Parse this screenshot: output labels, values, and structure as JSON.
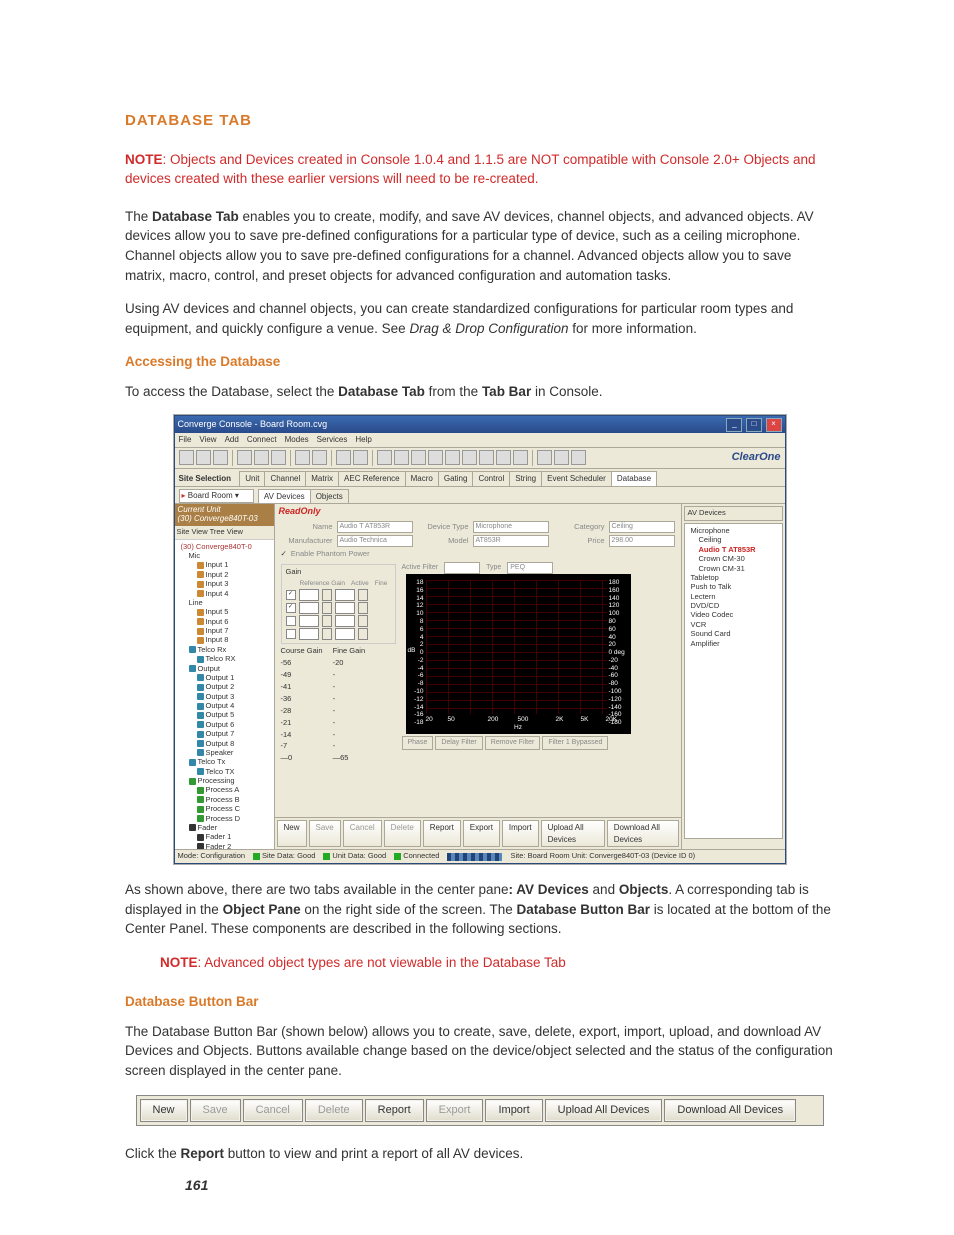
{
  "headings": {
    "main": "DATABASE TAB",
    "accessing": "Accessing the Database",
    "buttonbar": "Database Button Bar"
  },
  "note_top": {
    "prefix": "NOTE",
    "text": ": Objects and Devices created in Console 1.0.4 and 1.1.5 are NOT compatible with Console 2.0+ Objects and devices created with these earlier versions will need to be re-created."
  },
  "para1": {
    "a": "The ",
    "b": "Database Tab",
    "c": " enables you to create, modify, and save AV devices, channel objects, and advanced objects. AV devices allow you to save pre-defined configurations for a particular type of device, such as a ceiling microphone. Channel objects allow you to save pre-defined configurations for a channel. Advanced objects allow you to save matrix, macro, control, and preset objects for advanced configuration and automation tasks."
  },
  "para2": {
    "a": "Using AV devices and channel objects, you can create standardized configurations for particular room types and equipment, and quickly configure a venue. See ",
    "em": "Drag & Drop Configuration",
    "b": " for more information."
  },
  "para3": {
    "a": "To access the Database, select the ",
    "b": "Database Tab",
    "c": " from the ",
    "d": "Tab Bar",
    "e": " in Console."
  },
  "para4": {
    "a": "As shown above, there are two tabs available in the center pane",
    "b": ": AV Devices",
    "c": " and ",
    "d": "Objects",
    "e": ". A corresponding tab is displayed in the ",
    "f": "Object Pane",
    "g": " on the right side of the screen. The ",
    "h": "Database Button Bar",
    "i": " is located at the bottom of the Center Panel. These components are described in the following sections."
  },
  "note_mid": {
    "prefix": "NOTE",
    "text": ": Advanced object types are not viewable in the Database Tab"
  },
  "para5": "The Database Button Bar (shown below) allows you to create, save, delete, export, import, upload, and download AV Devices and Objects. Buttons available change based on the device/object selected and the status of the configuration screen displayed in the center pane.",
  "para6": {
    "a": "Click the ",
    "b": "Report",
    "c": " button to view and print a report of all AV devices."
  },
  "page_number": "161",
  "window": {
    "title": "Converge Console - Board Room.cvg",
    "menus": [
      "File",
      "View",
      "Add",
      "Connect",
      "Modes",
      "Services",
      "Help"
    ],
    "brand": "ClearOne",
    "site_selection": "Site Selection",
    "site_val": "Board Room",
    "tabs": [
      "Unit",
      "Channel",
      "Matrix",
      "AEC Reference",
      "Macro",
      "Gating",
      "Control",
      "String",
      "Event Scheduler",
      "Database"
    ],
    "subtabs": [
      "AV Devices",
      "Objects"
    ],
    "readonly": "ReadOnly",
    "current_unit": {
      "label": "Current Unit",
      "value": "(30) Converge840T-03"
    },
    "tree_head": "Site View   Tree View",
    "left_tree": [
      {
        "lvl": "i1",
        "txt": "(30) Converge840T-0"
      },
      {
        "lvl": "i2",
        "ic": "",
        "txt": "Mic"
      },
      {
        "lvl": "i3",
        "ic": "ic",
        "txt": "Input 1"
      },
      {
        "lvl": "i3",
        "ic": "ic",
        "txt": "Input 2"
      },
      {
        "lvl": "i3",
        "ic": "ic",
        "txt": "Input 3"
      },
      {
        "lvl": "i3",
        "ic": "ic",
        "txt": "Input 4"
      },
      {
        "lvl": "i2",
        "ic": "",
        "txt": "Line"
      },
      {
        "lvl": "i3",
        "ic": "ic",
        "txt": "Input 5"
      },
      {
        "lvl": "i3",
        "ic": "ic",
        "txt": "Input 6"
      },
      {
        "lvl": "i3",
        "ic": "ic",
        "txt": "Input 7"
      },
      {
        "lvl": "i3",
        "ic": "ic",
        "txt": "Input 8"
      },
      {
        "lvl": "i2",
        "ic": "ic b",
        "txt": "Telco Rx"
      },
      {
        "lvl": "i3",
        "ic": "ic b",
        "txt": "Telco RX"
      },
      {
        "lvl": "i2",
        "ic": "ic b",
        "txt": "Output"
      },
      {
        "lvl": "i3",
        "ic": "ic b",
        "txt": "Output 1"
      },
      {
        "lvl": "i3",
        "ic": "ic b",
        "txt": "Output 2"
      },
      {
        "lvl": "i3",
        "ic": "ic b",
        "txt": "Output 3"
      },
      {
        "lvl": "i3",
        "ic": "ic b",
        "txt": "Output 4"
      },
      {
        "lvl": "i3",
        "ic": "ic b",
        "txt": "Output 5"
      },
      {
        "lvl": "i3",
        "ic": "ic b",
        "txt": "Output 6"
      },
      {
        "lvl": "i3",
        "ic": "ic b",
        "txt": "Output 7"
      },
      {
        "lvl": "i3",
        "ic": "ic b",
        "txt": "Output 8"
      },
      {
        "lvl": "i3",
        "ic": "ic b",
        "txt": "Speaker"
      },
      {
        "lvl": "i2",
        "ic": "ic b",
        "txt": "Telco Tx"
      },
      {
        "lvl": "i3",
        "ic": "ic b",
        "txt": "Telco TX"
      },
      {
        "lvl": "i2",
        "ic": "ic g",
        "txt": "Processing"
      },
      {
        "lvl": "i3",
        "ic": "ic g",
        "txt": "Process A"
      },
      {
        "lvl": "i3",
        "ic": "ic g",
        "txt": "Process B"
      },
      {
        "lvl": "i3",
        "ic": "ic g",
        "txt": "Process C"
      },
      {
        "lvl": "i3",
        "ic": "ic g",
        "txt": "Process D"
      },
      {
        "lvl": "i2",
        "ic": "ic k",
        "txt": "Fader"
      },
      {
        "lvl": "i3",
        "ic": "ic k",
        "txt": "Fader 1"
      },
      {
        "lvl": "i3",
        "ic": "ic k",
        "txt": "Fader 2"
      }
    ],
    "form": {
      "labels": {
        "name": "Name",
        "mfr": "Manufacturer",
        "devtype": "Device Type",
        "model": "Model",
        "category": "Category",
        "price": "Price"
      },
      "name": "Audio T AT853R",
      "mfr": "Audio Technica",
      "devtype": "Microphone",
      "model": "AT853R",
      "category": "Ceiling",
      "price": "298.00",
      "phantom": "Enable Phantom Power",
      "gain_title": "Gain",
      "gain_hdr": [
        "",
        "Reference Gain",
        "Active",
        "Fine",
        "Active Filter",
        "Type"
      ],
      "peq_val": "PEQ",
      "checks": [
        "✓",
        "✓",
        "",
        ""
      ],
      "coarse_title": "Course Gain",
      "fine_title": "Fine Gain",
      "coarse": [
        "-56",
        "-49",
        "-41",
        "-36",
        "-28",
        "-21",
        "-14",
        "-7",
        "—0"
      ],
      "fine": [
        "-20",
        "-",
        "-",
        "-",
        "-",
        "-",
        "-",
        "-",
        "—65"
      ]
    },
    "right_header": "AV Devices",
    "right_tree": [
      {
        "lvl": "i1",
        "txt": "Microphone"
      },
      {
        "lvl": "i2",
        "txt": "Ceiling"
      },
      {
        "lvl": "i2",
        "sel": true,
        "txt": "Audio T AT853R"
      },
      {
        "lvl": "i2",
        "txt": "Crown CM-30"
      },
      {
        "lvl": "i2",
        "txt": "Crown CM-31"
      },
      {
        "lvl": "i1",
        "txt": "Tabletop"
      },
      {
        "lvl": "i1",
        "txt": "Push to Talk"
      },
      {
        "lvl": "i1",
        "txt": "Lectern"
      },
      {
        "lvl": "i1",
        "txt": "DVD/CD"
      },
      {
        "lvl": "i1",
        "txt": "Video Codec"
      },
      {
        "lvl": "i1",
        "txt": "VCR"
      },
      {
        "lvl": "i1",
        "txt": "Sound Card"
      },
      {
        "lvl": "i1",
        "txt": "Amplifier"
      }
    ],
    "bottom_buttons": [
      {
        "label": "New",
        "dis": false
      },
      {
        "label": "Save",
        "dis": true
      },
      {
        "label": "Cancel",
        "dis": true
      },
      {
        "label": "Delete",
        "dis": true
      },
      {
        "label": "Report",
        "dis": false
      },
      {
        "label": "Export",
        "dis": false
      },
      {
        "label": "Import",
        "dis": false
      },
      {
        "label": "Upload All Devices",
        "dis": false
      },
      {
        "label": "Download All Devices",
        "dis": false
      }
    ],
    "status": {
      "mode": "Mode: Configuration",
      "site": "Site Data: Good",
      "unit": "Unit Data: Good",
      "conn": "Connected",
      "info": "Site: Board Room   Unit: Converge840T-03 (Device ID 0)"
    },
    "chart_btn_labels": [
      "Phase",
      "Delay Filter",
      "Remove Filter",
      "Filter 1 Bypassed"
    ]
  },
  "chart_data": {
    "type": "line",
    "title": "",
    "xlabel": "Hz",
    "ylabel_left": "dB",
    "ylabel_right": "deg",
    "x_ticks": [
      20,
      50,
      200,
      500,
      "2K",
      "5K",
      "20K"
    ],
    "y_ticks_left": [
      18,
      16,
      14,
      12,
      10,
      8,
      6,
      4,
      2,
      0,
      -2,
      -4,
      -6,
      -8,
      -10,
      -12,
      -14,
      -16,
      -18
    ],
    "y_ticks_right": [
      180,
      160,
      140,
      120,
      100,
      80,
      60,
      40,
      20,
      "0 deg",
      -20,
      -40,
      -60,
      -80,
      -100,
      -120,
      -140,
      -160,
      -180
    ],
    "series": [
      {
        "name": "response",
        "x": [
          20,
          50,
          200,
          500,
          2000,
          5000,
          20000
        ],
        "values": [
          0,
          0,
          0,
          0,
          0,
          0,
          0
        ]
      }
    ],
    "xlim": [
      20,
      20000
    ],
    "ylim_left": [
      -18,
      18
    ],
    "ylim_right": [
      -180,
      180
    ]
  },
  "standalone_buttons": [
    {
      "label": "New",
      "dis": false
    },
    {
      "label": "Save",
      "dis": true
    },
    {
      "label": "Cancel",
      "dis": true
    },
    {
      "label": "Delete",
      "dis": true
    },
    {
      "label": "Report",
      "dis": false
    },
    {
      "label": "Export",
      "dis": true
    },
    {
      "label": "Import",
      "dis": false
    },
    {
      "label": "Upload All Devices",
      "dis": false
    },
    {
      "label": "Download All Devices",
      "dis": false
    }
  ]
}
